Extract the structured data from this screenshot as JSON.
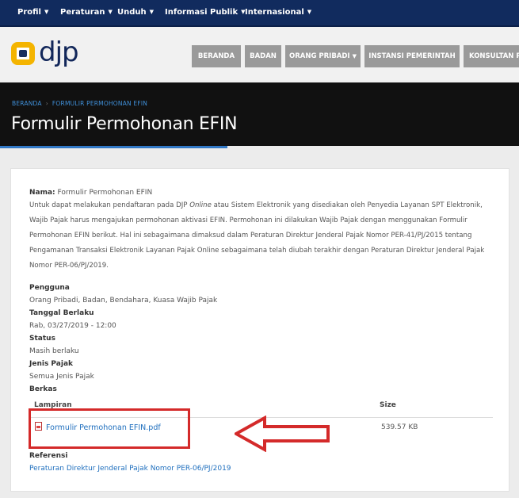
{
  "topnav": {
    "items": [
      {
        "label": "Profil"
      },
      {
        "label": "Peraturan"
      },
      {
        "label": "Unduh"
      },
      {
        "label": "Informasi Publik"
      },
      {
        "label": "Internasional"
      }
    ]
  },
  "header": {
    "logo_text": "djp",
    "nav": [
      {
        "label": "BERANDA"
      },
      {
        "label": "BADAN"
      },
      {
        "label": "ORANG PRIBADI"
      },
      {
        "label": "INSTANSI PEMERINTAH"
      },
      {
        "label": "KONSULTAN P"
      }
    ]
  },
  "breadcrumb": {
    "home": "BERANDA",
    "current": "FORMULIR PERMOHONAN EFIN"
  },
  "page_title": "Formulir Permohonan EFIN",
  "detail": {
    "name_label": "Nama:",
    "name_value": "Formulir Permohonan EFIN",
    "description_pre": "Untuk dapat melakukan pendaftaran pada DJP ",
    "description_online": "Online",
    "description_post": " atau Sistem Elektronik yang disediakan oleh Penyedia Layanan SPT Elektronik, Wajib Pajak harus mengajukan permohonan aktivasi EFIN. Permohonan ini dilakukan Wajib Pajak dengan menggunakan Formulir Permohonan EFIN berikut. Hal ini sebagaimana dimaksud dalam Peraturan Direktur Jenderal Pajak Nomor PER-41/PJ/2015 tentang Pengamanan Transaksi Elektronik Layanan Pajak Online sebagaimana telah diubah terakhir dengan Peraturan Direktur Jenderal Pajak Nomor PER-06/PJ/2019.",
    "pengguna_label": "Pengguna",
    "pengguna_value": "Orang Pribadi, Badan, Bendahara, Kuasa Wajib Pajak",
    "tanggal_label": "Tanggal Berlaku",
    "tanggal_value": "Rab, 03/27/2019 - 12:00",
    "status_label": "Status",
    "status_value": "Masih berlaku",
    "jenis_label": "Jenis Pajak",
    "jenis_value": "Semua Jenis Pajak",
    "berkas_label": "Berkas",
    "table": {
      "col_lampiran": "Lampiran",
      "col_size": "Size",
      "file_name": "Formulir Permohonan EFIN.pdf",
      "file_size": "539.57 KB"
    },
    "referensi_label": "Referensi",
    "referensi_link": "Peraturan Direktur Jenderal Pajak Nomor PER-06/PJ/2019"
  },
  "colors": {
    "topnav_bg": "#112b5e",
    "nav_button_bg": "#9a9a9a",
    "banner_bg": "#111111",
    "link": "#1f6fbe",
    "highlight": "#d42a2a",
    "logo_yellow": "#f4b400"
  }
}
